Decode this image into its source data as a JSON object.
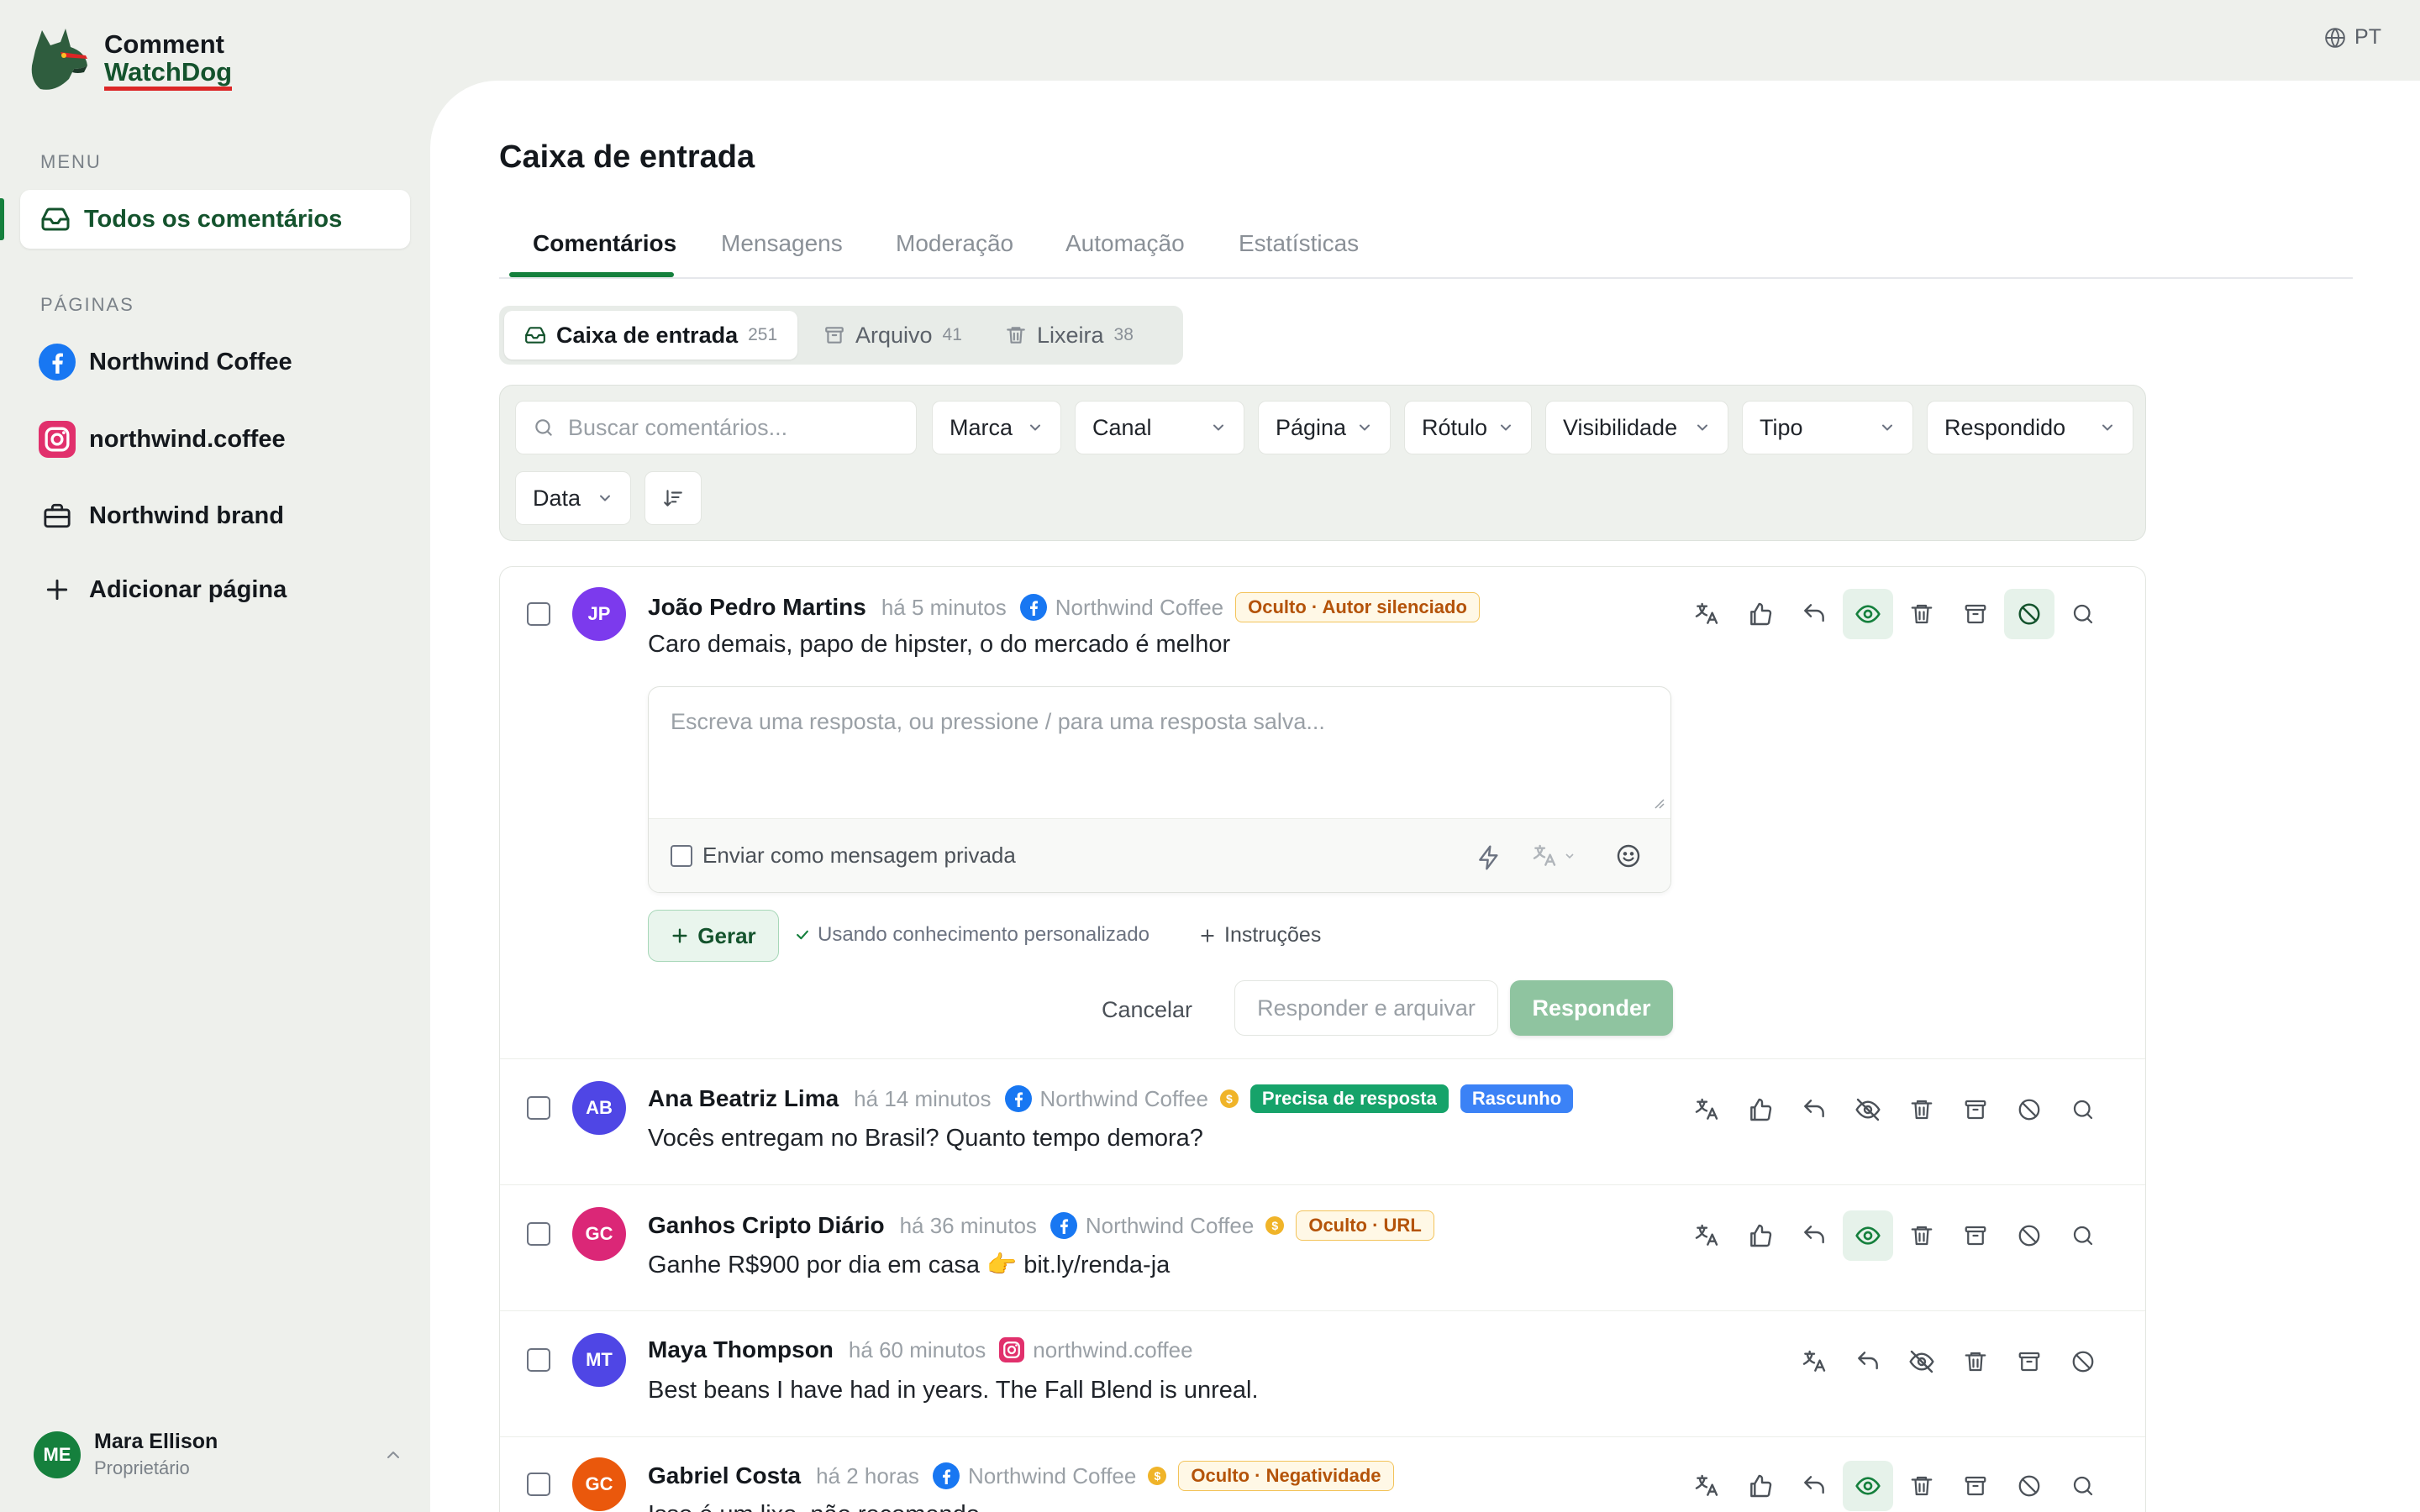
{
  "app": {
    "name_line1": "Comment",
    "name_line2": "WatchDog",
    "lang": "PT"
  },
  "sidebar": {
    "menu_label": "MENU",
    "active_item": "Todos os comentários",
    "pages_label": "PÁGINAS",
    "pages": [
      {
        "label": "Northwind Coffee",
        "icon": "facebook-icon"
      },
      {
        "label": "northwind.coffee",
        "icon": "instagram-icon"
      },
      {
        "label": "Northwind brand",
        "icon": "briefcase-icon"
      }
    ],
    "add_page": "Adicionar página"
  },
  "user": {
    "initials": "ME",
    "name": "Mara Ellison",
    "role": "Proprietário"
  },
  "header": {
    "title": "Caixa de entrada"
  },
  "tabs": [
    "Comentários",
    "Mensagens",
    "Moderação",
    "Automação",
    "Estatísticas"
  ],
  "subtabs": [
    {
      "label": "Caixa de entrada",
      "count": "251"
    },
    {
      "label": "Arquivo",
      "count": "41"
    },
    {
      "label": "Lixeira",
      "count": "38"
    }
  ],
  "filters": {
    "search_placeholder": "Buscar comentários...",
    "brand": "Marca",
    "channel": "Canal",
    "page": "Página",
    "label": "Rótulo",
    "visibility": "Visibilidade",
    "type": "Tipo",
    "answered": "Respondido",
    "date": "Data"
  },
  "reply_box": {
    "placeholder": "Escreva uma resposta, ou pressione / para uma resposta salva...",
    "private_label": "Enviar como mensagem privada",
    "generate": "Gerar",
    "knowledge": "Usando conhecimento personalizado",
    "instructions": "Instruções",
    "cancel": "Cancelar",
    "reply_archive": "Responder e arquivar",
    "reply": "Responder"
  },
  "comments": [
    {
      "initials": "JP",
      "color": "#7c3aed",
      "author": "João Pedro Martins",
      "time": "há 5 minutos",
      "page": "Northwind Coffee",
      "platform": "facebook",
      "badges": [
        {
          "text": "Oculto · Autor silenciado",
          "style": "amber"
        }
      ],
      "text": "Caro demais, papo de hipster, o do mercado é melhor"
    },
    {
      "initials": "AB",
      "color": "#4f46e5",
      "author": "Ana Beatriz Lima",
      "time": "há 14 minutos",
      "page": "Northwind Coffee",
      "platform": "facebook",
      "badges": [
        {
          "text": "Precisa de resposta",
          "style": "green"
        },
        {
          "text": "Rascunho",
          "style": "blue"
        }
      ],
      "text": "Vocês entregam no Brasil? Quanto tempo demora?"
    },
    {
      "initials": "GC",
      "color": "#db2777",
      "author": "Ganhos Cripto Diário",
      "time": "há 36 minutos",
      "page": "Northwind Coffee",
      "platform": "facebook",
      "badges": [
        {
          "text": "Oculto · URL",
          "style": "amber"
        }
      ],
      "text": "Ganhe R$900 por dia em casa 👉 bit.ly/renda-ja"
    },
    {
      "initials": "MT",
      "color": "#4f46e5",
      "author": "Maya Thompson",
      "time": "há 60 minutos",
      "page": "northwind.coffee",
      "platform": "instagram",
      "badges": [],
      "text": "Best beans I have had in years. The Fall Blend is unreal."
    },
    {
      "initials": "GC",
      "color": "#ea580c",
      "author": "Gabriel Costa",
      "time": "há 2 horas",
      "page": "Northwind Coffee",
      "platform": "facebook",
      "badges": [
        {
          "text": "Oculto · Negatividade",
          "style": "amber"
        }
      ],
      "text": "Isso é um lixo, não recomendo"
    }
  ],
  "colors": {
    "accent": "#15803d",
    "brand_dark": "#14532d",
    "underline": "#dc2626"
  }
}
